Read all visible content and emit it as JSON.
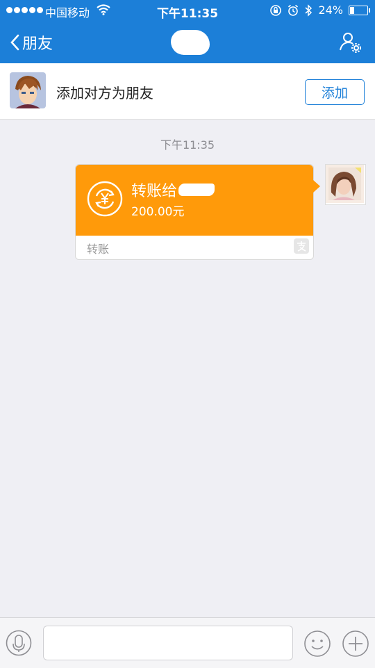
{
  "status_bar": {
    "carrier": "中国移动",
    "time": "下午11:35",
    "battery": "24%",
    "battery_level": 0.24
  },
  "nav": {
    "back_label": "朋友"
  },
  "add_friend": {
    "prompt": "添加对方为朋友",
    "button_label": "添加"
  },
  "chat": {
    "timestamp": "下午11:35",
    "transfer": {
      "title": "转账给",
      "amount": "200.00元",
      "footer_label": "转账"
    }
  },
  "colors": {
    "primary": "#1c7fd8",
    "transfer_orange": "#ff9a0a"
  },
  "icons": [
    "wifi-icon",
    "alarm-icon",
    "bluetooth-icon",
    "battery-icon",
    "back-chevron-icon",
    "profile-settings-icon",
    "transfer-yuan-icon",
    "alipay-icon",
    "mic-icon",
    "emoji-icon",
    "plus-icon"
  ]
}
